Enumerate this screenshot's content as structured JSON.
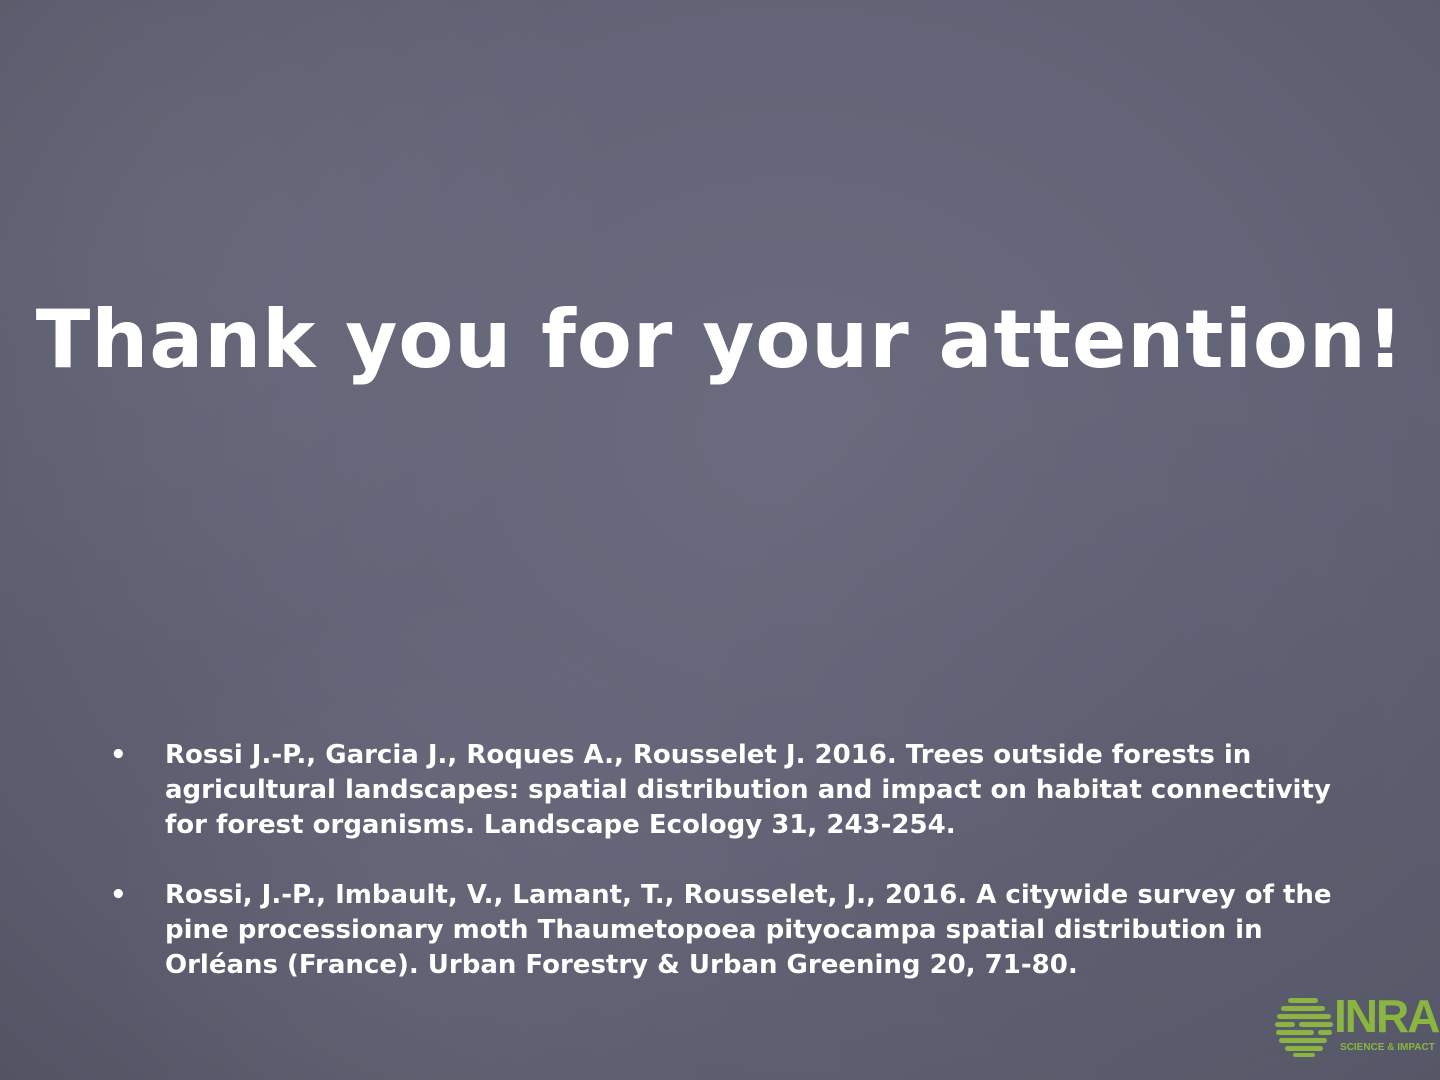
{
  "slide": {
    "title": "Thank you for your attention!",
    "references": [
      {
        "bullet": "•",
        "text": "Rossi J.-P., Garcia J., Roques A., Rousselet J. 2016. Trees outside forests in agricultural landscapes: spatial distribution and impact on habitat connectivity for forest organisms. Landscape Ecology 31, 243-254."
      },
      {
        "bullet": "•",
        "text": "Rossi, J.-P., Imbault, V., Lamant, T., Rousselet, J., 2016. A citywide survey of the pine processionary moth Thaumetopoea pityocampa spatial distribution in Orléans (France). Urban Forestry & Urban Greening 20, 71-80."
      }
    ]
  },
  "logo": {
    "name": "INRA",
    "tagline": "SCIENCE & IMPACT",
    "icon": "inra-globe-icon",
    "color": "#8ab540"
  },
  "colors": {
    "background": "#636477",
    "text": "#ffffff"
  }
}
